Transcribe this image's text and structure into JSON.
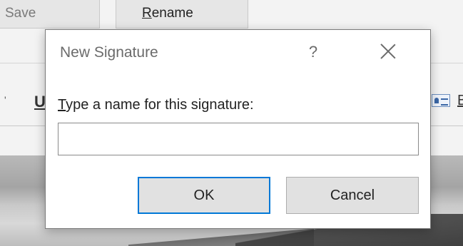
{
  "background": {
    "save_label": "Save",
    "rename_label": "Rename",
    "rename_accel": "R",
    "rename_rest": "ename",
    "underline_glyph": "U",
    "edge_glyph": "B"
  },
  "dialog": {
    "title": "New Signature",
    "help_glyph": "?",
    "label_accel": "T",
    "label_rest": "ype a name for this signature:",
    "input_value": "",
    "ok_label": "OK",
    "cancel_label": "Cancel"
  },
  "colors": {
    "focus_border": "#0078d7",
    "button_bg": "#e1e1e1",
    "dialog_bg": "#ffffff"
  },
  "icons": [
    "close-icon",
    "help-icon",
    "business-card-icon"
  ]
}
